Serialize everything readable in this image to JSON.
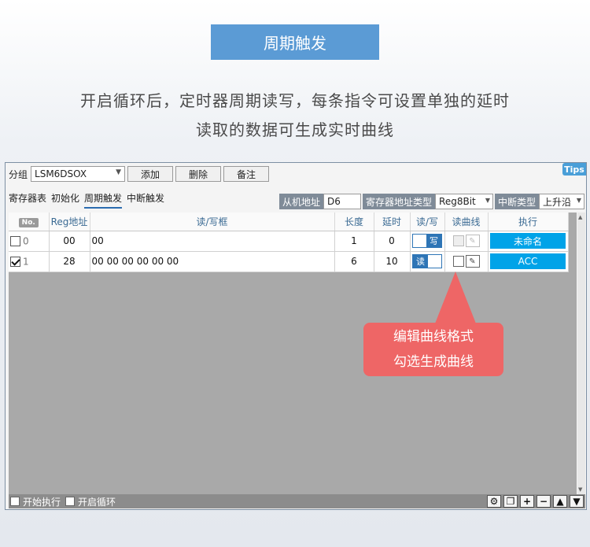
{
  "banner": {
    "title": "周期触发"
  },
  "description": {
    "line1": "开启循环后，定时器周期读写，每条指令可设置单独的延时",
    "line2": "读取的数据可生成实时曲线"
  },
  "app": {
    "tips_label": "Tips",
    "toolbar": {
      "group_label": "分组",
      "group_value": "LSM6DSOX",
      "add_label": "添加",
      "delete_label": "删除",
      "note_label": "备注"
    },
    "tabs": [
      {
        "label": "寄存器表",
        "active": false
      },
      {
        "label": "初始化",
        "active": false
      },
      {
        "label": "周期触发",
        "active": true
      },
      {
        "label": "中断触发",
        "active": false
      }
    ],
    "registers": {
      "slave_addr_label": "从机地址",
      "slave_addr_value": "D6",
      "addr_type_label": "寄存器地址类型",
      "addr_type_value": "Reg8Bit",
      "int_type_label": "中断类型",
      "int_type_value": "上升沿"
    },
    "table": {
      "columns": [
        "No.",
        "Reg地址",
        "读/写框",
        "长度",
        "延时",
        "读/写",
        "读曲线",
        "执行"
      ],
      "rows": [
        {
          "checked": false,
          "index": "0",
          "reg": "00",
          "data": "00",
          "length": "1",
          "delay": "0",
          "rw": "写",
          "rw_mode": "write",
          "curve": false,
          "exec": "未命名"
        },
        {
          "checked": true,
          "index": "1",
          "reg": "28",
          "data": "00 00 00 00 00 00",
          "length": "6",
          "delay": "10",
          "rw": "读",
          "rw_mode": "read",
          "curve": true,
          "exec": "ACC"
        }
      ]
    },
    "callout": {
      "line1": "编辑曲线格式",
      "line2": "勾选生成曲线",
      "color": "#ee6666"
    },
    "statusbar": {
      "start_exec_label": "开始执行",
      "loop_label": "开启循环",
      "buttons": [
        "settings-icon",
        "copy-icon",
        "plus-icon",
        "minus-icon",
        "up-icon",
        "down-icon"
      ]
    },
    "colors": {
      "accent": "#2e75b6",
      "exec_button": "#00a3e8",
      "banner": "#5b9bd5"
    }
  }
}
